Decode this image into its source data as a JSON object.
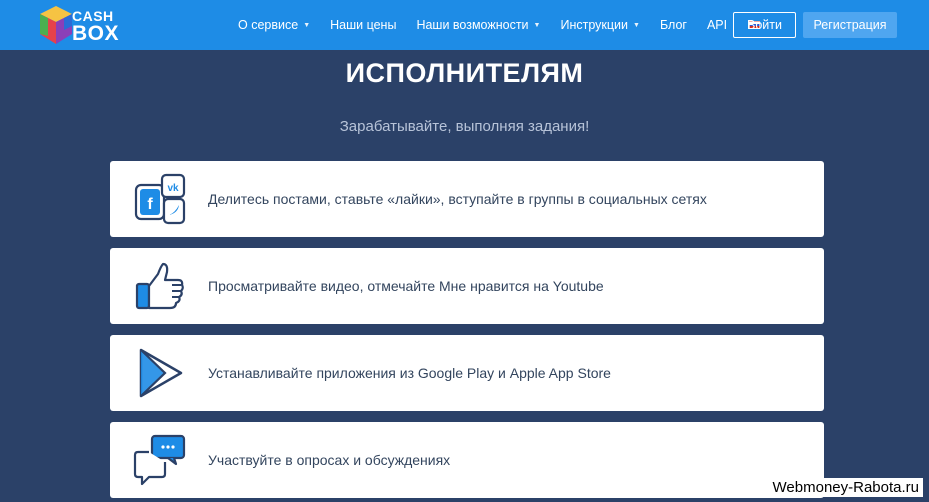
{
  "header": {
    "logo": {
      "line1": "CASH",
      "line2": "BOX"
    },
    "nav": [
      {
        "label": "О сервисе",
        "dropdown": true
      },
      {
        "label": "Наши цены",
        "dropdown": false
      },
      {
        "label": "Наши возможности",
        "dropdown": true
      },
      {
        "label": "Инструкции",
        "dropdown": true
      },
      {
        "label": "Блог",
        "dropdown": false
      },
      {
        "label": "API",
        "dropdown": false
      }
    ],
    "language_icon": "russia-flag-icon",
    "login_label": "Войти",
    "register_label": "Регистрация"
  },
  "hero": {
    "title": "ИСПОЛНИТЕЛЯМ",
    "subtitle": "Зарабатывайте, выполняя задания!"
  },
  "features": [
    {
      "icon": "social-networks-icon",
      "text": "Делитесь постами, ставьте «лайки», вступайте в группы в социальных сетях"
    },
    {
      "icon": "thumbs-up-icon",
      "text": "Просматривайте видео, отмечайте Мне нравится на Youtube"
    },
    {
      "icon": "play-store-icon",
      "text": "Устанавливайте приложения из Google Play и Apple App Store"
    },
    {
      "icon": "chat-bubbles-icon",
      "text": "Участвуйте в опросах и обсуждениях"
    }
  ],
  "watermark": "Webmoney-Rabota.ru",
  "colors": {
    "header_bg": "#1e8ce6",
    "page_bg": "#2b4168",
    "card_bg": "#ffffff",
    "icon_primary": "#1e8ce6",
    "icon_outline": "#2b4168",
    "register_bg": "#4fa6f0"
  }
}
